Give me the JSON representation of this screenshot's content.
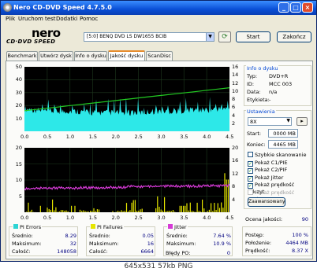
{
  "window": {
    "title": "Nero CD-DVD Speed 4.7.5.0"
  },
  "menu": [
    "Plik",
    "Uruchom test",
    "Dodatki",
    "Pomoc"
  ],
  "logo": {
    "brand": "nero",
    "sub": "CD·DVD SPEED"
  },
  "drive": {
    "value": "[5:0]  BENQ DVD LS DW1655 BCIB"
  },
  "buttons": {
    "start": "Start",
    "close": "Zakończ",
    "advanced": "Zaawansowany"
  },
  "tabs": [
    "Benchmark",
    "Utwórz dysk",
    "Info o dysku",
    "Jakość dysku",
    "ScanDisc"
  ],
  "active_tab": "Jakość dysku",
  "disc_info": {
    "title": "Info o dysku",
    "rows": [
      {
        "k": "Typ:",
        "v": "DVD+R"
      },
      {
        "k": "ID:",
        "v": "MCC 003"
      },
      {
        "k": "Data:",
        "v": "n/a"
      },
      {
        "k": "Etykieta:",
        "v": "-"
      }
    ]
  },
  "settings": {
    "title": "Ustawienia",
    "speed": "8X",
    "start_label": "Start:",
    "start_value": "0000 MB",
    "end_label": "Koniec:",
    "end_value": "4465 MB",
    "checkboxes": [
      {
        "label": "Szybkie skanowanie",
        "checked": false,
        "disabled": false
      },
      {
        "label": "Pokaż C1/PIE",
        "checked": true,
        "disabled": false
      },
      {
        "label": "Pokaż C2/PIF",
        "checked": true,
        "disabled": false
      },
      {
        "label": "Pokaż Jitter",
        "checked": true,
        "disabled": false
      },
      {
        "label": "Pokaż prędkość odczyt",
        "checked": true,
        "disabled": false
      },
      {
        "label": "Pokaż prędkość zapisu",
        "checked": false,
        "disabled": true
      }
    ]
  },
  "quality": {
    "label": "Ocena jakości:",
    "value": "90"
  },
  "pi_errors": {
    "title": "PI Errors",
    "color": "#2dd4d4",
    "rows": [
      {
        "k": "Średnio:",
        "v": "8.29"
      },
      {
        "k": "Maksimum:",
        "v": "32"
      },
      {
        "k": "Całość:",
        "v": "148058"
      }
    ]
  },
  "pi_failures": {
    "title": "PI Failures",
    "color": "#e6e600",
    "rows": [
      {
        "k": "Średnio:",
        "v": "0.05"
      },
      {
        "k": "Maksimum:",
        "v": "16"
      },
      {
        "k": "Całość:",
        "v": "6664"
      }
    ]
  },
  "jitter": {
    "title": "Jitter",
    "color": "#d63ad6",
    "rows": [
      {
        "k": "Średnio:",
        "v": "7.64 %"
      },
      {
        "k": "Maksimum:",
        "v": "10.9 %"
      }
    ],
    "po_label": "Błędy PO:",
    "po_value": "0"
  },
  "progress": {
    "rows": [
      {
        "k": "Postęp:",
        "v": "100 %"
      },
      {
        "k": "Położenie:",
        "v": "4464 MB"
      },
      {
        "k": "Prędkość:",
        "v": "8.37 X"
      }
    ]
  },
  "caption": "645x531 57kb PNG",
  "chart_data": [
    {
      "type": "area",
      "x_ticks": [
        "0.0",
        "0.5",
        "1.0",
        "1.5",
        "2.0",
        "2.5",
        "3.0",
        "3.5",
        "4.0",
        "4.5"
      ],
      "y_left_ticks": [
        "50",
        "40",
        "30",
        "20",
        "10"
      ],
      "y_right_ticks": [
        "16",
        "14",
        "12",
        "10",
        "8",
        "6",
        "4",
        "2"
      ],
      "xlim": [
        0,
        4.5
      ],
      "ylim": [
        0,
        50
      ],
      "series": [
        {
          "color": "#2de8e8",
          "values": [
            15,
            14,
            13,
            13,
            13,
            13,
            12,
            12,
            12,
            12,
            12,
            12,
            13,
            13,
            13,
            14,
            14,
            14,
            15,
            15
          ]
        },
        {
          "color": "#22cc22",
          "values": [
            5.1,
            5.4,
            5.7,
            6.0,
            6.3,
            6.6,
            6.9,
            7.2,
            7.5,
            7.8,
            8.1,
            8.4,
            8.7,
            9.0,
            9.3,
            9.6,
            9.9,
            10.2,
            10.5,
            10.8
          ]
        }
      ]
    },
    {
      "type": "bar",
      "x_ticks": [
        "0.0",
        "0.5",
        "1.0",
        "1.5",
        "2.0",
        "2.5",
        "3.0",
        "3.5",
        "4.0",
        "4.5"
      ],
      "y_left_ticks": [
        "20",
        "15",
        "10",
        "5"
      ],
      "y_right_ticks": [
        "20",
        "16",
        "12",
        "8",
        "4"
      ],
      "xlim": [
        0,
        4.5
      ],
      "ylim": [
        0,
        20
      ],
      "series": [
        {
          "color": "#d63ad6",
          "values": [
            7.3,
            7.4,
            7.5,
            7.5,
            7.5,
            7.6,
            7.6,
            7.6,
            7.7,
            7.7,
            8.0,
            8.0,
            8.0,
            8.1,
            8.1,
            8.1,
            8.1,
            8.2,
            8.2,
            8.4
          ]
        },
        {
          "color": "#e6e600",
          "values": [
            1,
            0,
            2,
            1,
            0,
            1,
            2,
            0,
            1,
            1,
            2,
            0,
            3,
            1,
            0,
            1,
            2,
            1,
            4,
            15
          ]
        }
      ]
    }
  ]
}
